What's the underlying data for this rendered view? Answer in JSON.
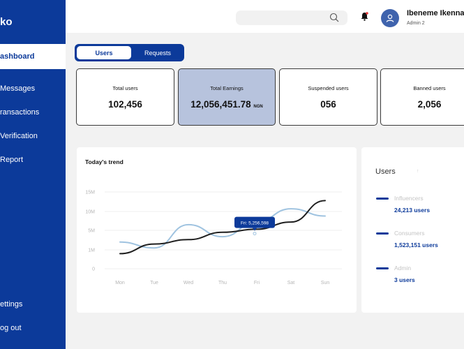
{
  "sidebar": {
    "logo": "ko",
    "items": [
      {
        "label": "ashboard",
        "active": true
      },
      {
        "label": "Messages"
      },
      {
        "label": "ransactions"
      },
      {
        "label": "Verification"
      },
      {
        "label": "Report"
      },
      {
        "label": "ettings"
      },
      {
        "label": "og out"
      }
    ]
  },
  "header": {
    "search_placeholder": "",
    "search_icon": "search-icon",
    "notification_icon": "bell-icon",
    "user": {
      "name": "Ibeneme Ikenna",
      "role": "Admin 2",
      "avatar_icon": "user-icon"
    }
  },
  "tabs": [
    {
      "label": "Users",
      "active": true
    },
    {
      "label": "Requests",
      "active": false
    }
  ],
  "stats": [
    {
      "label": "Total users",
      "value": "102,456"
    },
    {
      "label": "Total Earnings",
      "value": "12,056,451.78",
      "unit": "NGN",
      "highlighted": true
    },
    {
      "label": "Suspended users",
      "value": "056"
    },
    {
      "label": "Banned  users",
      "value": "2,056"
    }
  ],
  "trend": {
    "title": "Today's trend",
    "tooltip": "Fri: 5,256,598"
  },
  "chart_data": {
    "type": "line",
    "categories": [
      "Mon",
      "Tue",
      "Wed",
      "Thu",
      "Fri",
      "Sat",
      "Sun"
    ],
    "yticks": [
      "0",
      "1M",
      "5M",
      "10M",
      "15M"
    ],
    "series": [
      {
        "values": [
          0.8,
          2.2,
          3.1,
          4.6,
          5.3,
          7.2,
          12.8
        ],
        "color": "#1f1f1f"
      },
      {
        "values": [
          2.6,
          1.4,
          6.5,
          3.7,
          7.3,
          10.7,
          8.8
        ],
        "color": "#9fc3e0"
      }
    ],
    "tooltip_point": {
      "category": "Fri",
      "value": 5256598
    }
  },
  "users_panel": {
    "title": "Users",
    "items": [
      {
        "label": "Influencers",
        "value": "24,213 users"
      },
      {
        "label": "Consumers",
        "value": "1,523,151 users"
      },
      {
        "label": "Admin",
        "value": "3 users"
      }
    ],
    "accent": "#0c3a9a"
  }
}
